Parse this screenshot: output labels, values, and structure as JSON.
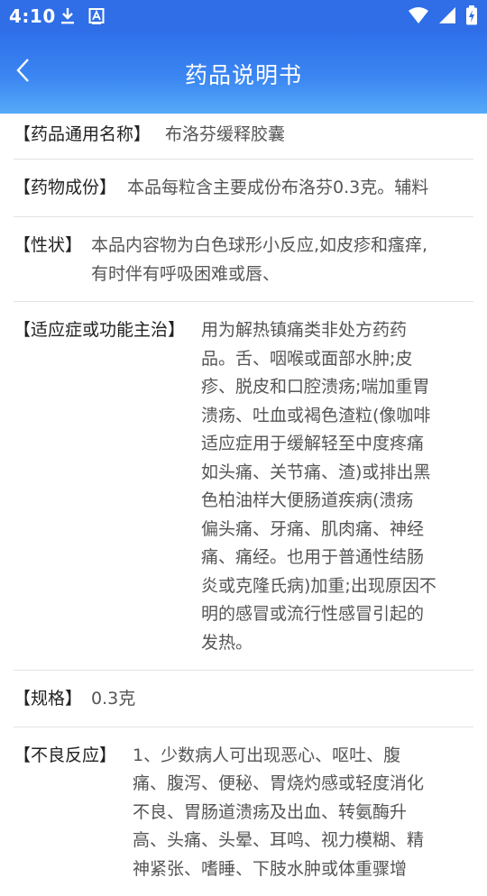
{
  "status_bar": {
    "time": "4:10",
    "left_icons": [
      "download-icon",
      "font-a-icon"
    ],
    "right_icons": [
      "wifi-icon",
      "signal-icon",
      "battery-icon"
    ]
  },
  "header": {
    "title": "药品说明书",
    "back_icon": "chevron-left-icon"
  },
  "colors": {
    "header_top": "#2f70ea",
    "header_bottom": "#55aaf8",
    "divider": "#e2e2e2",
    "label": "#222222",
    "value": "#555555"
  },
  "sections": [
    {
      "label": "【药品通用名称】",
      "value": "布洛芬缓释胶囊"
    },
    {
      "label": "【药物成份】",
      "value": "本品每粒含主要成份布洛芬0.3克。辅料"
    },
    {
      "label": "【性状】",
      "value": "本品内容物为白色球形小反应,如皮疹和瘙痒,\n有时伴有呼吸困难或唇、"
    },
    {
      "label": "【适应症或功能主治】",
      "value": "用为解热镇痛类非处方药药\n品。舌、咽喉或面部水肿;皮\n疹、脱皮和口腔溃疡;喘加重胃\n溃疡、吐血或褐色渣粒(像咖啡\n适应症用于缓解轻至中度疼痛\n如头痛、关节痛、渣)或排出黑\n色柏油样大便肠道疾病(溃疡\n偏头痛、牙痛、肌肉痛、神经\n痛、痛经。也用于普通性结肠\n炎或克隆氏病)加重;出现原因不\n明的感冒或流行性感冒引起的\n发热。"
    },
    {
      "label": "【规格】",
      "value": "0.3克"
    },
    {
      "label": "【不良反应】",
      "value": "1、少数病人可出现恶心、呕吐、腹\n痛、腹泻、便秘、胃烧灼感或轻度消化\n不良、胃肠道溃疡及出血、转氨酶升\n高、头痛、头晕、耳鸣、视力模糊、精\n神紧张、嗜睡、下肢水肿或体重骤增"
    }
  ]
}
